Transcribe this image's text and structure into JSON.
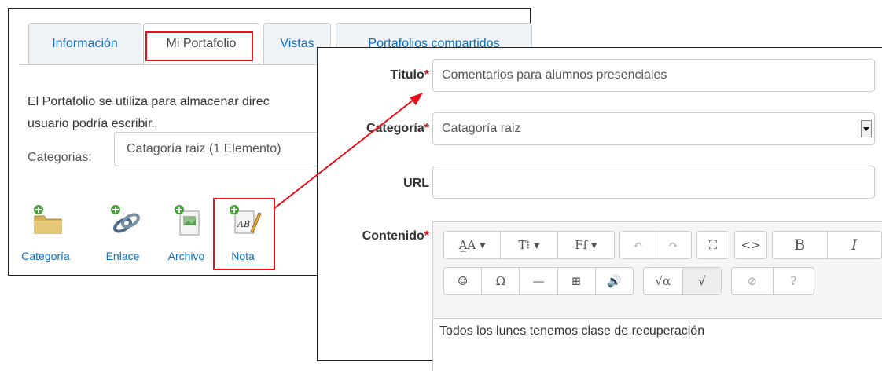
{
  "tabs": [
    {
      "label": "Información",
      "active": false
    },
    {
      "label": "Mi Portafolio",
      "active": true
    },
    {
      "label": "Vistas",
      "active": false
    },
    {
      "label": "Portafolios compartidos",
      "active": false
    }
  ],
  "portfolio": {
    "description_line1": "El Portafolio se utiliza para almacenar direc",
    "description_line2": "usuario podría escribir.",
    "categories_label": "Categorias:",
    "categories_value": "Catagoría raiz (1 Elemento)"
  },
  "actions": [
    {
      "label": "Categoría",
      "icon": "folder-add-icon"
    },
    {
      "label": "Enlace",
      "icon": "link-add-icon"
    },
    {
      "label": "Archivo",
      "icon": "file-add-icon"
    },
    {
      "label": "Nota",
      "icon": "note-add-icon"
    }
  ],
  "form": {
    "title_label": "Titulo",
    "title_value": "Comentarios para alumnos presenciales",
    "category_label": "Categoría",
    "category_value": "Catagoría raiz",
    "url_label": "URL",
    "url_value": "",
    "content_label": "Contenido",
    "required_mark": "*",
    "content_text": "Todos los lunes tenemos clase de recuperación"
  },
  "editor_toolbar": {
    "row1": [
      "A̲A ▾",
      "T⁝ ▾",
      "Ff ▾",
      "↶",
      "↷",
      "⛶",
      "<>",
      "B",
      "I"
    ],
    "row2": [
      "☺",
      "Ω",
      "—",
      "⊞",
      "🔊",
      "√α",
      "√",
      "⊘",
      "?"
    ]
  },
  "colors": {
    "accent": "#0f6cbf",
    "highlight": "#e8101a",
    "required": "#cc1a1a"
  }
}
